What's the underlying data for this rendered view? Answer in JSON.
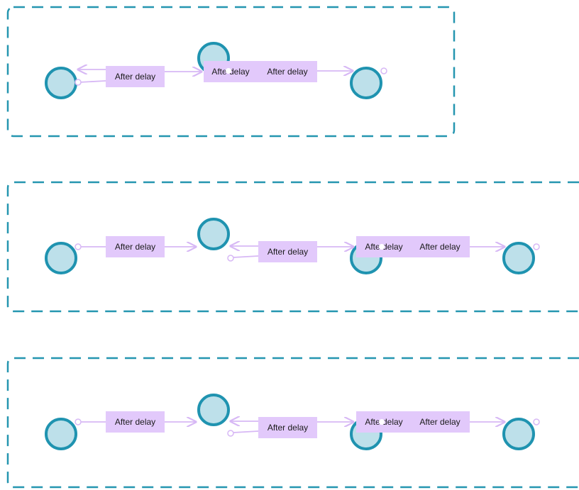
{
  "colors": {
    "frame": "#2596b0",
    "node_fill": "#bde0ea",
    "node_stroke": "#1f93b0",
    "arrow": "#d7b8f5",
    "label_bg": "#e2c9fb",
    "label_text": "#1a1a1a"
  },
  "transition_label": "After delay",
  "overlap_text": "Afte delay",
  "groups": [
    {
      "name": "flow-1",
      "labels": [
        "After delay",
        "After delay",
        "After delay"
      ]
    },
    {
      "name": "flow-2",
      "labels": [
        "After delay",
        "After delay",
        "After delay",
        "After delay"
      ]
    },
    {
      "name": "flow-3",
      "labels": [
        "After delay",
        "After delay",
        "After delay",
        "After delay"
      ]
    }
  ]
}
